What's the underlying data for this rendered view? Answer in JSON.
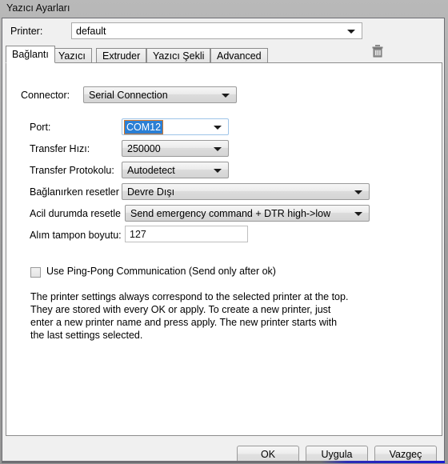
{
  "window": {
    "title": "Yazıcı Ayarları"
  },
  "printer": {
    "label": "Printer:",
    "value": "default",
    "delete_icon": "trash-icon"
  },
  "tabs": [
    {
      "label": "Bağlantı",
      "active": true
    },
    {
      "label": "Yazıcı",
      "active": false
    },
    {
      "label": "Extruder",
      "active": false
    },
    {
      "label": "Yazıcı Şekli",
      "active": false
    },
    {
      "label": "Advanced",
      "active": false
    }
  ],
  "fields": {
    "connector": {
      "label": "Connector:",
      "value": "Serial Connection"
    },
    "port": {
      "label": "Port:",
      "value": "COM12"
    },
    "transfer_speed": {
      "label": "Transfer Hızı:",
      "value": "250000"
    },
    "transfer_protocol": {
      "label": "Transfer Protokolu:",
      "value": "Autodetect"
    },
    "reset_on_connect": {
      "label": "Bağlanırken resetler",
      "value": "Devre Dışı"
    },
    "emergency_reset": {
      "label": "Acil durumda resetle",
      "value": "Send emergency command + DTR high->low"
    },
    "receive_buffer": {
      "label": "Alım tampon boyutu:",
      "value": "127"
    }
  },
  "pingpong": {
    "label": "Use Ping-Pong Communication (Send only after ok)",
    "checked": false
  },
  "description": "The printer settings always correspond to the selected printer at the top. They are stored with every OK or apply. To create a new printer, just enter a new printer name and press apply. The new printer starts with the last settings selected.",
  "buttons": {
    "ok": "OK",
    "apply": "Uygula",
    "cancel": "Vazgeç"
  },
  "colors": {
    "selection_blue": "#2a7fd4",
    "dialog_bg": "#f0f0f0",
    "page_bg": "#ffffff",
    "border": "#8c8c8c"
  }
}
